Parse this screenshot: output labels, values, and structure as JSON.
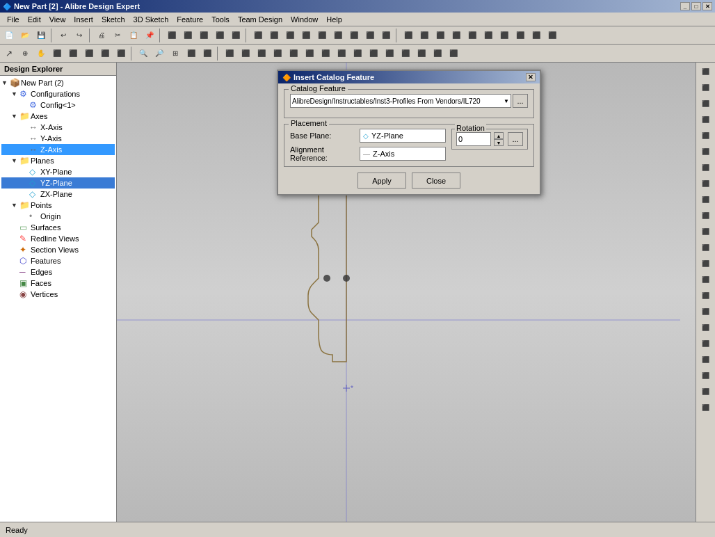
{
  "titleBar": {
    "title": "New Part [2] - Alibre Design Expert",
    "winButtons": [
      "_",
      "□",
      "✕"
    ]
  },
  "menuBar": {
    "items": [
      "File",
      "Edit",
      "View",
      "Insert",
      "Sketch",
      "3D Sketch",
      "Feature",
      "Tools",
      "Team Design",
      "Window",
      "Help"
    ]
  },
  "designExplorer": {
    "header": "Design Explorer",
    "tree": [
      {
        "id": "new-part",
        "label": "New Part (2)",
        "level": 0,
        "expander": "▼",
        "icon": "part"
      },
      {
        "id": "configurations",
        "label": "Configurations",
        "level": 1,
        "expander": "▼",
        "icon": "config"
      },
      {
        "id": "config1",
        "label": "Config<1>",
        "level": 2,
        "expander": "",
        "icon": "config"
      },
      {
        "id": "axes",
        "label": "Axes",
        "level": 1,
        "expander": "▼",
        "icon": "folder"
      },
      {
        "id": "x-axis",
        "label": "X-Axis",
        "level": 2,
        "expander": "",
        "icon": "axis"
      },
      {
        "id": "y-axis",
        "label": "Y-Axis",
        "level": 2,
        "expander": "",
        "icon": "axis"
      },
      {
        "id": "z-axis",
        "label": "Z-Axis",
        "level": 2,
        "expander": "",
        "icon": "axis",
        "selected": true
      },
      {
        "id": "planes",
        "label": "Planes",
        "level": 1,
        "expander": "▼",
        "icon": "folder"
      },
      {
        "id": "xy-plane",
        "label": "XY-Plane",
        "level": 2,
        "expander": "",
        "icon": "plane"
      },
      {
        "id": "yz-plane",
        "label": "YZ-Plane",
        "level": 2,
        "expander": "",
        "icon": "plane",
        "highlighted": true
      },
      {
        "id": "zx-plane",
        "label": "ZX-Plane",
        "level": 2,
        "expander": "",
        "icon": "plane"
      },
      {
        "id": "points",
        "label": "Points",
        "level": 1,
        "expander": "▼",
        "icon": "folder"
      },
      {
        "id": "origin",
        "label": "Origin",
        "level": 2,
        "expander": "",
        "icon": "point"
      },
      {
        "id": "surfaces",
        "label": "Surfaces",
        "level": 1,
        "expander": "",
        "icon": "surface"
      },
      {
        "id": "redline-views",
        "label": "Redline Views",
        "level": 1,
        "expander": "",
        "icon": "redline"
      },
      {
        "id": "section-views",
        "label": "Section Views",
        "level": 1,
        "expander": "",
        "icon": "section"
      },
      {
        "id": "features",
        "label": "Features",
        "level": 1,
        "expander": "",
        "icon": "feature"
      },
      {
        "id": "edges",
        "label": "Edges",
        "level": 1,
        "expander": "",
        "icon": "edge"
      },
      {
        "id": "faces",
        "label": "Faces",
        "level": 1,
        "expander": "",
        "icon": "face"
      },
      {
        "id": "vertices",
        "label": "Vertices",
        "level": 1,
        "expander": "",
        "icon": "vertex"
      }
    ]
  },
  "dialog": {
    "title": "Insert Catalog Feature",
    "catalogFeatureLabel": "Catalog Feature",
    "catalogPath": "AlibreDesign/Instructables/Inst3-Profiles From Vendors/IL720",
    "placementLabel": "Placement",
    "basePlaneLabel": "Base Plane:",
    "basePlaneValue": "YZ-Plane",
    "alignmentRefLabel": "Alignment Reference:",
    "alignmentRefValue": "Z-Axis",
    "rotationLabel": "Rotation",
    "rotationValue": "0",
    "applyButton": "Apply",
    "closeButton": "Close",
    "ellipsis": "..."
  },
  "statusBar": {
    "text": "Ready"
  }
}
